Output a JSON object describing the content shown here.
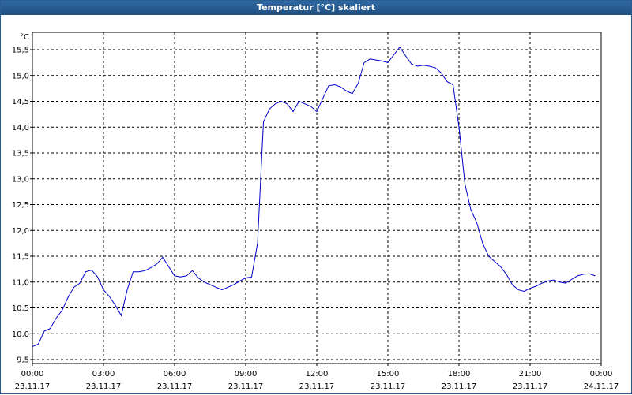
{
  "window": {
    "title": "Temperatur [°C] skaliert"
  },
  "colors": {
    "line": "#0000cc",
    "grid": "#000000",
    "title_bar": "#1f4f80"
  },
  "chart_data": {
    "type": "line",
    "title": "Temperatur [°C] skaliert",
    "unit_label": "°C",
    "xlabel": "",
    "ylabel": "",
    "ylim": [
      9.5,
      15.5
    ],
    "y_ticks": [
      "9,5",
      "10,0",
      "10,5",
      "11,0",
      "11,5",
      "12,0",
      "12,5",
      "13,0",
      "13,5",
      "14,0",
      "14,5",
      "15,0",
      "15,5"
    ],
    "x_ticks": [
      {
        "time": "00:00",
        "date": "23.11.17"
      },
      {
        "time": "03:00",
        "date": "23.11.17"
      },
      {
        "time": "06:00",
        "date": "23.11.17"
      },
      {
        "time": "09:00",
        "date": "23.11.17"
      },
      {
        "time": "12:00",
        "date": "23.11.17"
      },
      {
        "time": "15:00",
        "date": "23.11.17"
      },
      {
        "time": "18:00",
        "date": "23.11.17"
      },
      {
        "time": "21:00",
        "date": "23.11.17"
      },
      {
        "time": "00:00",
        "date": "24.11.17"
      }
    ],
    "xlim": [
      "23.11.17 00:00",
      "24.11.17 00:00"
    ],
    "grid": true,
    "series": [
      {
        "x": [
          "00:00",
          "00:15",
          "00:30",
          "00:45",
          "01:00",
          "01:15",
          "01:30",
          "01:45",
          "02:00",
          "02:15",
          "02:30",
          "02:45",
          "03:00",
          "03:15",
          "03:30",
          "03:45",
          "04:00",
          "04:15",
          "04:30",
          "04:45",
          "05:00",
          "05:15",
          "05:30",
          "05:45",
          "06:00",
          "06:15",
          "06:30",
          "06:45",
          "07:00",
          "07:15",
          "07:30",
          "07:45",
          "08:00",
          "08:15",
          "08:30",
          "08:45",
          "09:00",
          "09:15",
          "09:30",
          "09:45",
          "10:00",
          "10:15",
          "10:30",
          "10:45",
          "11:00",
          "11:15",
          "11:30",
          "11:45",
          "12:00",
          "12:15",
          "12:30",
          "12:45",
          "13:00",
          "13:15",
          "13:30",
          "13:45",
          "14:00",
          "14:15",
          "14:30",
          "14:45",
          "15:00",
          "15:15",
          "15:30",
          "15:45",
          "16:00",
          "16:15",
          "16:30",
          "16:45",
          "17:00",
          "17:15",
          "17:30",
          "17:45",
          "18:00",
          "18:15",
          "18:30",
          "18:45",
          "19:00",
          "19:15",
          "19:30",
          "19:45",
          "20:00",
          "20:15",
          "20:30",
          "20:45",
          "21:00",
          "21:15",
          "21:30",
          "21:45",
          "22:00",
          "22:15",
          "22:30",
          "22:45",
          "23:00",
          "23:15",
          "23:30",
          "23:45"
        ],
        "y": [
          9.75,
          9.8,
          10.05,
          10.1,
          10.3,
          10.45,
          10.7,
          10.9,
          10.98,
          11.2,
          11.23,
          11.1,
          10.85,
          10.72,
          10.55,
          10.35,
          10.85,
          11.2,
          11.2,
          11.22,
          11.28,
          11.35,
          11.48,
          11.3,
          11.12,
          11.1,
          11.12,
          11.22,
          11.08,
          11.0,
          10.95,
          10.9,
          10.85,
          10.9,
          10.95,
          11.02,
          11.08,
          11.1,
          11.75,
          14.1,
          14.35,
          14.45,
          14.5,
          14.45,
          14.3,
          14.5,
          14.45,
          14.4,
          14.3,
          14.55,
          14.8,
          14.82,
          14.78,
          14.7,
          14.65,
          14.85,
          15.25,
          15.32,
          15.3,
          15.28,
          15.25,
          15.4,
          15.55,
          15.38,
          15.22,
          15.18,
          15.2,
          15.18,
          15.15,
          15.05,
          14.88,
          14.82,
          14.0,
          12.9,
          12.4,
          12.15,
          11.75,
          11.5,
          11.4,
          11.3,
          11.15,
          10.95,
          10.85,
          10.82,
          10.88,
          10.92,
          10.98,
          11.02,
          11.04,
          11.0,
          10.98,
          11.05,
          11.12,
          11.15,
          11.16,
          11.12
        ]
      }
    ]
  }
}
